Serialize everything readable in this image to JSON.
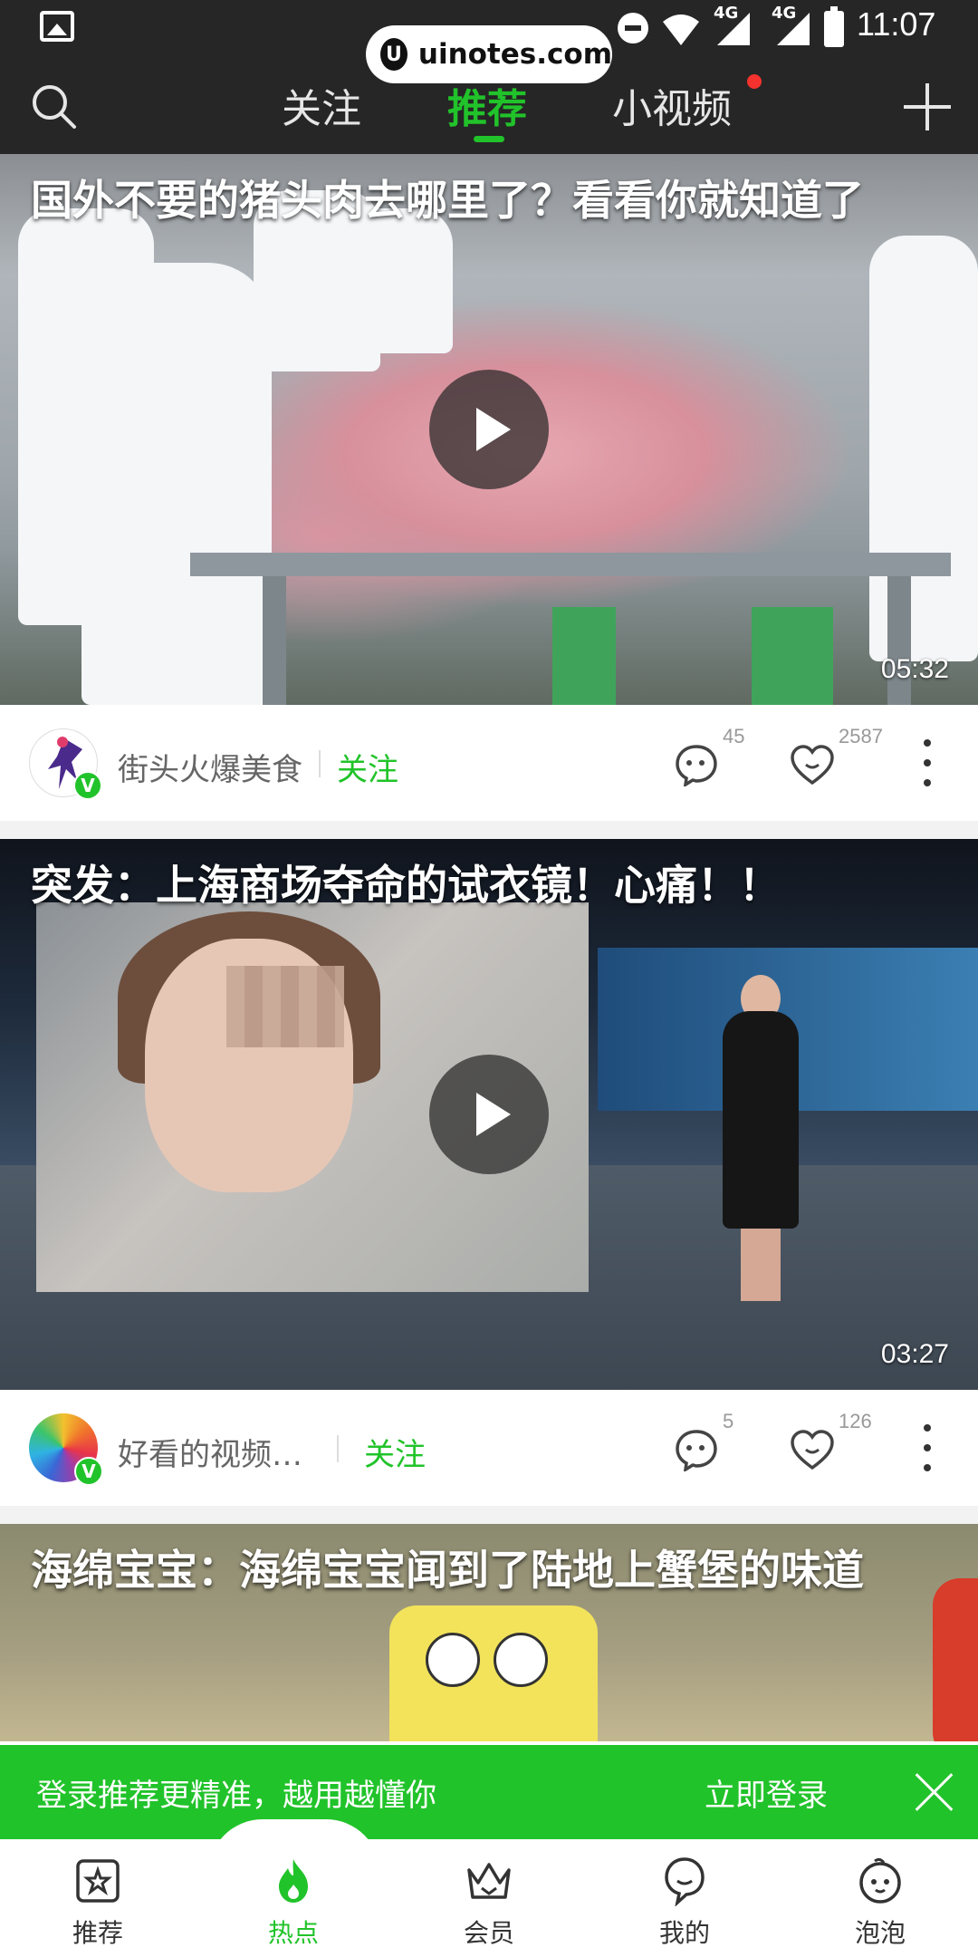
{
  "status_bar": {
    "watermark": "uinotes.com",
    "network_1": "4G",
    "network_2": "4G",
    "time": "11:07"
  },
  "top_tabs": [
    {
      "label": "关注",
      "active": false
    },
    {
      "label": "推荐",
      "active": true
    },
    {
      "label": "小视频",
      "active": false,
      "has_dot": true
    }
  ],
  "feed": [
    {
      "title": "国外不要的猪头肉去哪里了？看看你就知道了",
      "duration": "05:32",
      "author": "街头火爆美食",
      "follow_label": "关注",
      "comments": "45",
      "likes": "2587"
    },
    {
      "title": "突发：上海商场夺命的试衣镜！心痛！！",
      "duration": "03:27",
      "author": "好看的视频精...",
      "follow_label": "关注",
      "comments": "5",
      "likes": "126"
    },
    {
      "title": "海绵宝宝：海绵宝宝闻到了陆地上蟹堡的味道"
    }
  ],
  "verified_badge": "V",
  "login_banner": {
    "message": "登录推荐更精准，越用越懂你",
    "action": "立即登录"
  },
  "bottom_nav": [
    {
      "label": "推荐",
      "icon": "star-box-icon",
      "active": false
    },
    {
      "label": "热点",
      "icon": "flame-icon",
      "active": true
    },
    {
      "label": "会员",
      "icon": "crown-icon",
      "active": false
    },
    {
      "label": "我的",
      "icon": "profile-icon",
      "active": false
    },
    {
      "label": "泡泡",
      "icon": "bubble-face-icon",
      "active": false
    }
  ],
  "colors": {
    "accent": "#21c32a",
    "topbar": "#262626",
    "dot": "#f5322e"
  }
}
